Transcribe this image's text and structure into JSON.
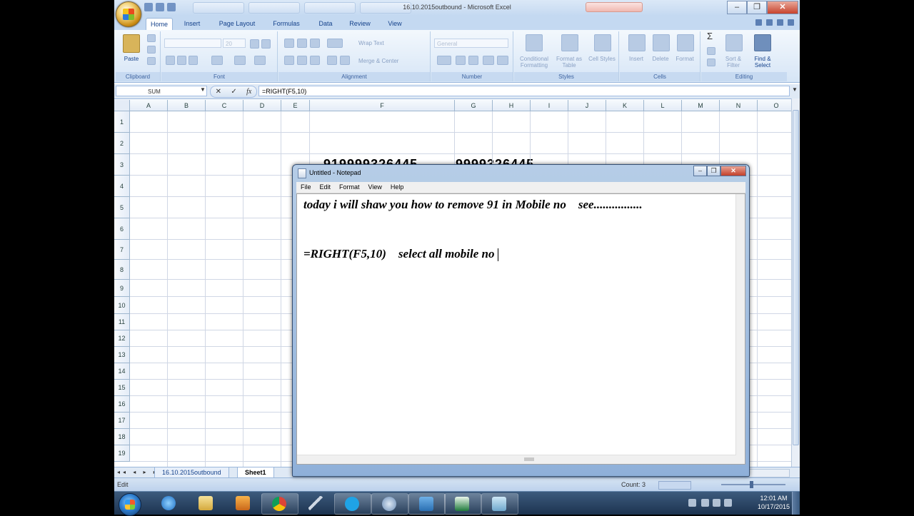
{
  "excel": {
    "title": "16.10.2015outbound - Microsoft Excel",
    "tabs": [
      "Home",
      "Insert",
      "Page Layout",
      "Formulas",
      "Data",
      "Review",
      "View"
    ],
    "ribbon": {
      "paste_label": "Paste",
      "font_name": "",
      "font_size": "20",
      "wrap_text": "Wrap Text",
      "merge_center": "Merge & Center",
      "number_format": "General",
      "conditional_formatting": "Conditional Formatting",
      "format_as_table": "Format as Table",
      "cell_styles": "Cell Styles",
      "insert": "Insert",
      "delete": "Delete",
      "format": "Format",
      "sort_filter": "Sort & Filter",
      "find_select": "Find & Select",
      "groups": [
        "Clipboard",
        "Font",
        "Alignment",
        "Number",
        "Styles",
        "Cells",
        "Editing"
      ]
    },
    "name_box": "SUM",
    "formula": "=RIGHT(F5,10)",
    "columns": [
      "A",
      "B",
      "C",
      "D",
      "E",
      "F",
      "G",
      "H",
      "I",
      "J",
      "K",
      "L",
      "M",
      "N",
      "O"
    ],
    "rows": [
      "1",
      "2",
      "3",
      "4",
      "5",
      "6",
      "7",
      "8",
      "9",
      "10",
      "11",
      "12",
      "13",
      "14",
      "15",
      "16",
      "17",
      "18",
      "19"
    ],
    "cells": {
      "F3": "919999326445",
      "G3": "9999326445"
    },
    "sheet_tabs": [
      "16.10.2015outbound",
      "Sheet1"
    ],
    "status_mode": "Edit",
    "status_count": "Count: 3"
  },
  "notepad": {
    "title": "Untitled - Notepad",
    "menu": [
      "File",
      "Edit",
      "Format",
      "View",
      "Help"
    ],
    "line1": "today i will shaw you how to remove 91 in Mobile no    see................",
    "line2": "=RIGHT(F5,10)    select all mobile no"
  },
  "taskbar": {
    "time": "12:01 AM",
    "date": "10/17/2015"
  },
  "colors": {
    "ribbon_blue": "#c4d9f1",
    "excel_green": "#1f7a3b",
    "taskbar": "#1c3350"
  },
  "icons": [
    "office-button-icon",
    "save-icon",
    "undo-icon",
    "redo-icon",
    "paste-icon",
    "cut-icon",
    "copy-icon",
    "format-painter-icon",
    "bold-icon",
    "italic-icon",
    "underline-icon",
    "sigma-icon",
    "find-icon",
    "chrome-icon",
    "ie-icon",
    "folder-icon",
    "media-player-icon",
    "skype-icon",
    "excel-icon",
    "notepad-icon",
    "network-icon",
    "volume-icon",
    "flag-icon"
  ]
}
